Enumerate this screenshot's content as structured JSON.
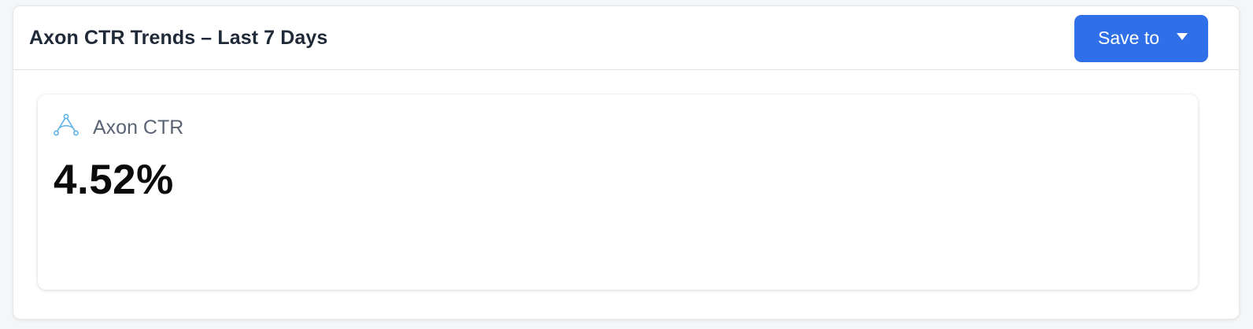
{
  "header": {
    "title": "Axon CTR Trends – Last 7 Days",
    "save_label": "Save to"
  },
  "metric": {
    "icon": "axon-triangle-icon",
    "label": "Axon CTR",
    "value": "4.52%"
  },
  "colors": {
    "accent": "#2f6fe8",
    "icon": "#5fb3e6",
    "title": "#1f2937",
    "label": "#5a6475"
  }
}
